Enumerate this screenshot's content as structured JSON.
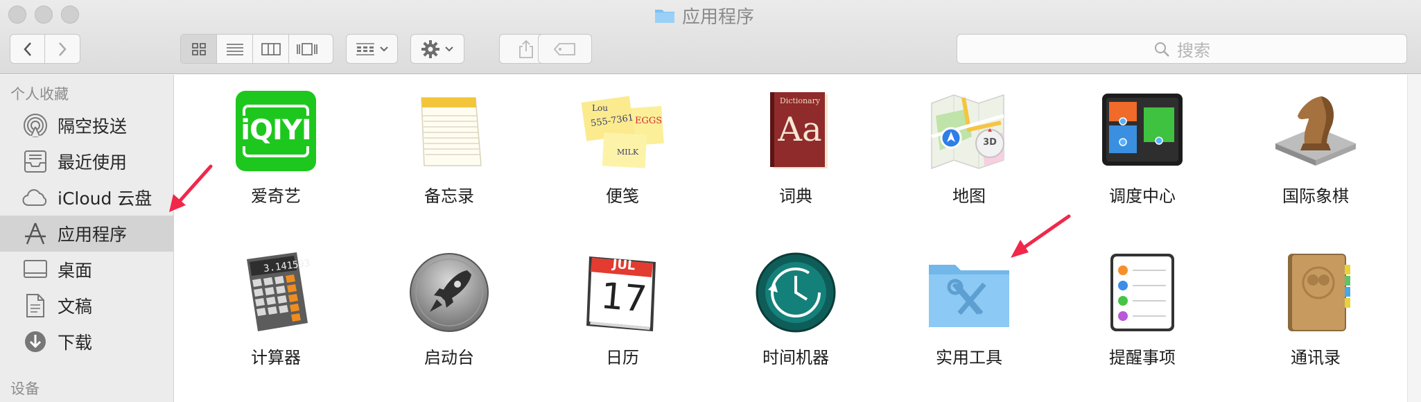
{
  "window": {
    "title": "应用程序",
    "folder_icon": "folder-icon"
  },
  "toolbar": {
    "back": "chevron-left-icon",
    "forward": "chevron-right-icon",
    "views": [
      "icon-view-icon",
      "list-view-icon",
      "column-view-icon",
      "gallery-view-icon"
    ],
    "active_view": 0,
    "arrange": "group-icon",
    "action": "gear-icon",
    "share": "share-icon",
    "tags": "tag-icon"
  },
  "search": {
    "placeholder": "搜索",
    "icon": "search-icon"
  },
  "sidebar": {
    "favorites_header": "个人收藏",
    "devices_header": "设备",
    "items": [
      {
        "label": "隔空投送",
        "icon": "airdrop-icon"
      },
      {
        "label": "最近使用",
        "icon": "recents-icon"
      },
      {
        "label": "iCloud 云盘",
        "icon": "cloud-icon"
      },
      {
        "label": "应用程序",
        "icon": "applications-icon",
        "selected": true
      },
      {
        "label": "桌面",
        "icon": "desktop-icon"
      },
      {
        "label": "文稿",
        "icon": "documents-icon"
      },
      {
        "label": "下载",
        "icon": "downloads-icon"
      }
    ]
  },
  "apps": [
    {
      "name": "爱奇艺",
      "icon": "iqiyi-icon",
      "icon_text": "iQIYI"
    },
    {
      "name": "备忘录",
      "icon": "notes-icon"
    },
    {
      "name": "便笺",
      "icon": "stickies-icon",
      "notes": [
        "Lou",
        "555-7361",
        "EGGS",
        "MILK"
      ]
    },
    {
      "name": "词典",
      "icon": "dictionary-icon",
      "book_title": "Dictionary",
      "book_text": "Aa"
    },
    {
      "name": "地图",
      "icon": "maps-icon",
      "badge": "3D"
    },
    {
      "name": "调度中心",
      "icon": "mission-control-icon"
    },
    {
      "name": "国际象棋",
      "icon": "chess-icon"
    },
    {
      "name": "计算器",
      "icon": "calculator-icon",
      "display": "3.141593"
    },
    {
      "name": "启动台",
      "icon": "launchpad-icon"
    },
    {
      "name": "日历",
      "icon": "calendar-icon",
      "month": "JUL",
      "day": "17"
    },
    {
      "name": "时间机器",
      "icon": "time-machine-icon"
    },
    {
      "name": "实用工具",
      "icon": "utilities-folder-icon"
    },
    {
      "name": "提醒事项",
      "icon": "reminders-icon"
    },
    {
      "name": "通讯录",
      "icon": "contacts-icon"
    }
  ],
  "colors": {
    "annotation_arrow": "#f0284a",
    "sidebar_bg": "#ececec",
    "sidebar_selected": "#d3d3d3",
    "iqiyi_green": "#1ec71e"
  }
}
